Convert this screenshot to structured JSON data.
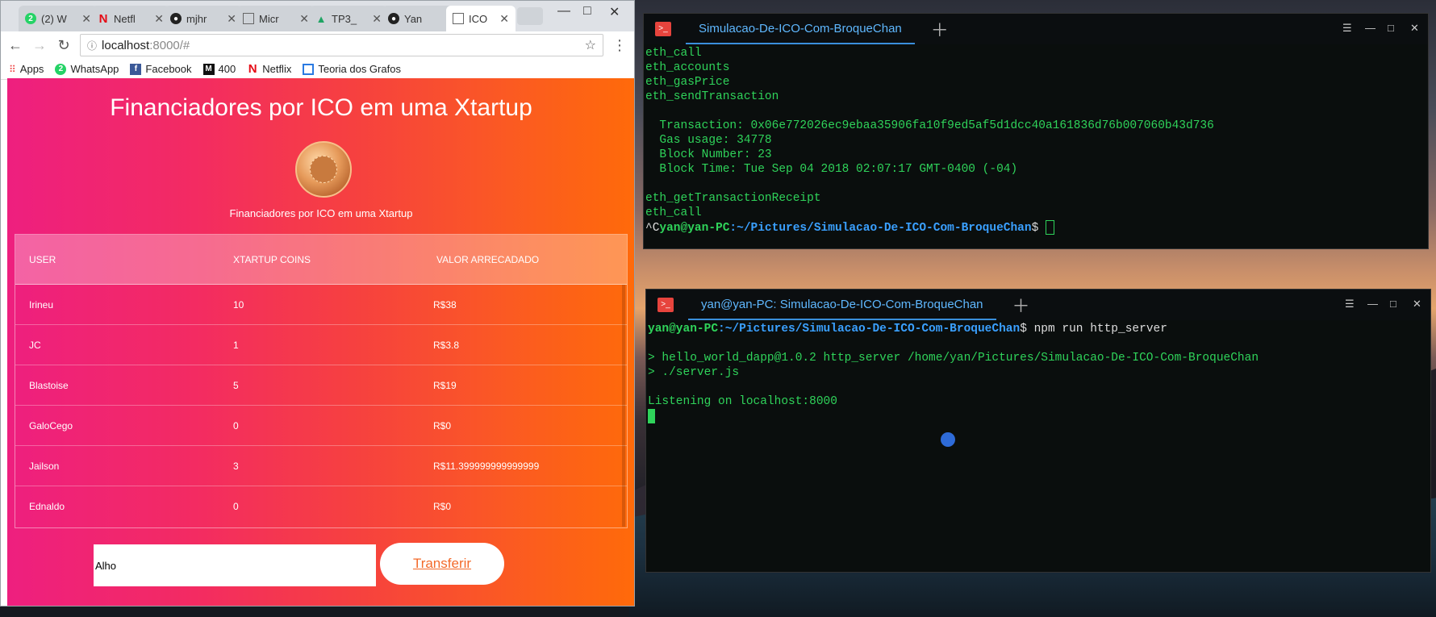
{
  "browser": {
    "tabs": [
      {
        "label": "(2) W",
        "icon": "whatsapp-icon"
      },
      {
        "label": "Netfl",
        "icon": "netflix-icon"
      },
      {
        "label": "mjhr",
        "icon": "github-icon"
      },
      {
        "label": "Micr",
        "icon": "document-icon"
      },
      {
        "label": "TP3_",
        "icon": "drive-icon"
      },
      {
        "label": "Yan",
        "icon": "github-icon"
      },
      {
        "label": "ICO",
        "icon": "document-icon"
      }
    ],
    "url_host": "localhost",
    "url_rest": ":8000/#",
    "bookmarks": [
      "Apps",
      "WhatsApp",
      "Facebook",
      "400",
      "Netflix",
      "Teoria dos Grafos"
    ]
  },
  "page": {
    "title": "Financiadores por ICO em uma Xtartup",
    "subtitle": "Financiadores por ICO em uma Xtartup",
    "headers": [
      "USER",
      "XTARTUP COINS",
      "VALOR ARRECADADO"
    ],
    "rows": [
      [
        "Irineu",
        "10",
        "R$38"
      ],
      [
        "JC",
        "1",
        "R$3.8"
      ],
      [
        "Blastoise",
        "5",
        "R$19"
      ],
      [
        "GaloCego",
        "0",
        "R$0"
      ],
      [
        "Jailson",
        "3",
        "R$11.399999999999999"
      ],
      [
        "Ednaldo",
        "0",
        "R$0"
      ]
    ],
    "input_value": "Alho",
    "transfer_label": "Transferir"
  },
  "terminal1": {
    "tab_label": "Simulacao-De-ICO-Com-BroqueChan",
    "lines": [
      "eth_call",
      "eth_accounts",
      "eth_gasPrice",
      "eth_sendTransaction",
      "",
      "  Transaction: 0x06e772026ec9ebaa35906fa10f9ed5af5d1dcc40a161836d76b007060b43d736",
      "  Gas usage: 34778",
      "  Block Number: 23",
      "  Block Time: Tue Sep 04 2018 02:07:17 GMT-0400 (-04)",
      "",
      "eth_getTransactionReceipt",
      "eth_call"
    ],
    "prompt_prefix": "^C",
    "prompt_user": "yan@yan-PC",
    "prompt_path": ":~/Pictures/Simulacao-De-ICO-Com-BroqueChan",
    "prompt_symbol": "$ "
  },
  "terminal2": {
    "tab_label": "yan@yan-PC: Simulacao-De-ICO-Com-BroqueChan",
    "prompt_user": "yan@yan-PC",
    "prompt_path": ":~/Pictures/Simulacao-De-ICO-Com-BroqueChan",
    "prompt_symbol": "$ ",
    "command": "npm run http_server",
    "lines": [
      "",
      "> hello_world_dapp@1.0.2 http_server /home/yan/Pictures/Simulacao-De-ICO-Com-BroqueChan",
      "> ./server.js",
      "",
      "Listening on localhost:8000"
    ]
  }
}
